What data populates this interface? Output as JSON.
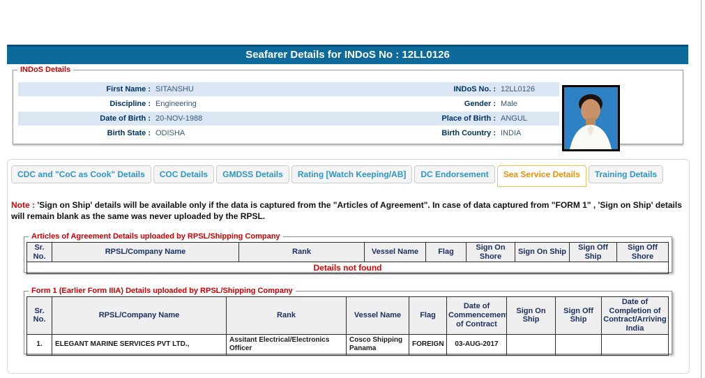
{
  "header": {
    "title": "Seafarer Details for INDoS No : 12LL0126"
  },
  "indos": {
    "legend": "INDoS Details",
    "rows": [
      {
        "left_label": "First Name :",
        "left_value": "SITANSHU",
        "right_label": "INDoS No. :",
        "right_value": "12LL0126"
      },
      {
        "left_label": "Discipline :",
        "left_value": "Engineering",
        "right_label": "Gender :",
        "right_value": "Male"
      },
      {
        "left_label": "Date of Birth :",
        "left_value": "20-NOV-1988",
        "right_label": "Place of Birth :",
        "right_value": "ANGUL"
      },
      {
        "left_label": "Birth State :",
        "left_value": "ODISHA",
        "right_label": "Birth Country :",
        "right_value": "INDIA"
      }
    ]
  },
  "tabs": [
    {
      "label": "CDC and \"CoC as Cook\" Details",
      "active": false
    },
    {
      "label": "COC Details",
      "active": false
    },
    {
      "label": "GMDSS Details",
      "active": false
    },
    {
      "label": "Rating [Watch Keeping/AB]",
      "active": false
    },
    {
      "label": "DC Endorsement",
      "active": false
    },
    {
      "label": "Sea Service Details",
      "active": true
    },
    {
      "label": "Training Details",
      "active": false
    }
  ],
  "note": {
    "prefix": "Note : ",
    "text": "'Sign on Ship' details will be available only if the data is captured from the \"Articles of Agreement\". In case of data captured from \"FORM 1\" , 'Sign on Ship' details will remain blank as the same was never uploaded by the RPSL."
  },
  "articles_table": {
    "legend": "Articles of Agreement Details uploaded by RPSL/Shipping Company",
    "headers": [
      "Sr. No.",
      "RPSL/Company Name",
      "Rank",
      "Vessel Name",
      "Flag",
      "Sign On Shore",
      "Sign On Ship",
      "Sign Off Ship",
      "Sign Off Shore"
    ],
    "empty_message": "Details not found"
  },
  "form1_table": {
    "legend": "Form 1 (Earlier Form IIIA) Details uploaded by RPSL/Shipping Company",
    "headers": [
      "Sr. No.",
      "RPSL/Company Name",
      "Rank",
      "Vessel Name",
      "Flag",
      "Date of Commencement of Contract",
      "Sign On Ship",
      "Sign Off Ship",
      "Date of Completion of Contract/Arriving India"
    ],
    "rows": [
      {
        "sr": "1.",
        "company": "ELEGANT MARINE SERVICES PVT LTD.,",
        "rank": "Assitant Electrical/Electronics Officer",
        "vessel": "Cosco Shipping Panama",
        "flag": "FOREIGN",
        "commencement": "03-AUG-2017",
        "sign_on_ship": "",
        "sign_off_ship": "",
        "completion": ""
      }
    ]
  },
  "colors": {
    "title_bar_bg": "#0E6A9A",
    "title_bar_text": "#FFFFFF",
    "legend_red": "#CC0000",
    "label_navy": "#003366",
    "row_highlight_blue": "#DBE6F3",
    "tab_text_blue": "#2E96C8",
    "active_tab_orange": "#EE9008",
    "note_red": "#E00000",
    "table_header_bg": "#EFEFEF",
    "photo_bg_blue": "#2E82C4"
  }
}
